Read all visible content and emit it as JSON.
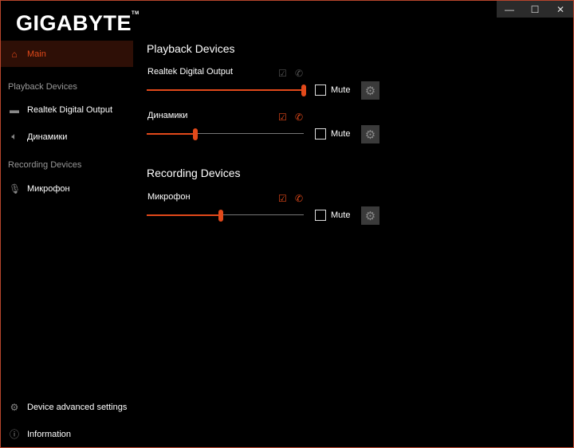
{
  "window": {
    "controls": [
      "—",
      "☐",
      "✕"
    ]
  },
  "logo": "GIGABYTE",
  "sidebar": {
    "main": "Main",
    "playback_heading": "Playback Devices",
    "recording_heading": "Recording Devices",
    "playback": [
      {
        "label": "Realtek Digital Output",
        "icon": "digital-output-icon"
      },
      {
        "label": "Динамики",
        "icon": "speaker-icon"
      }
    ],
    "recording": [
      {
        "label": "Микрофон",
        "icon": "microphone-icon"
      }
    ],
    "advanced": "Device advanced settings",
    "info": "Information"
  },
  "main": {
    "playback_title": "Playback Devices",
    "recording_title": "Recording Devices",
    "mute_label": "Mute",
    "devices": [
      {
        "name": "Realtek Digital Output",
        "volume_percent": 100,
        "default": false,
        "comm_default": false,
        "muted": false
      },
      {
        "name": "Динамики",
        "volume_percent": 31,
        "default": true,
        "comm_default": true,
        "muted": false
      },
      {
        "name": "Микрофон",
        "volume_percent": 47,
        "default": true,
        "comm_default": true,
        "muted": false
      }
    ]
  },
  "colors": {
    "accent": "#e2491a",
    "active_bg": "#2e0f06"
  }
}
